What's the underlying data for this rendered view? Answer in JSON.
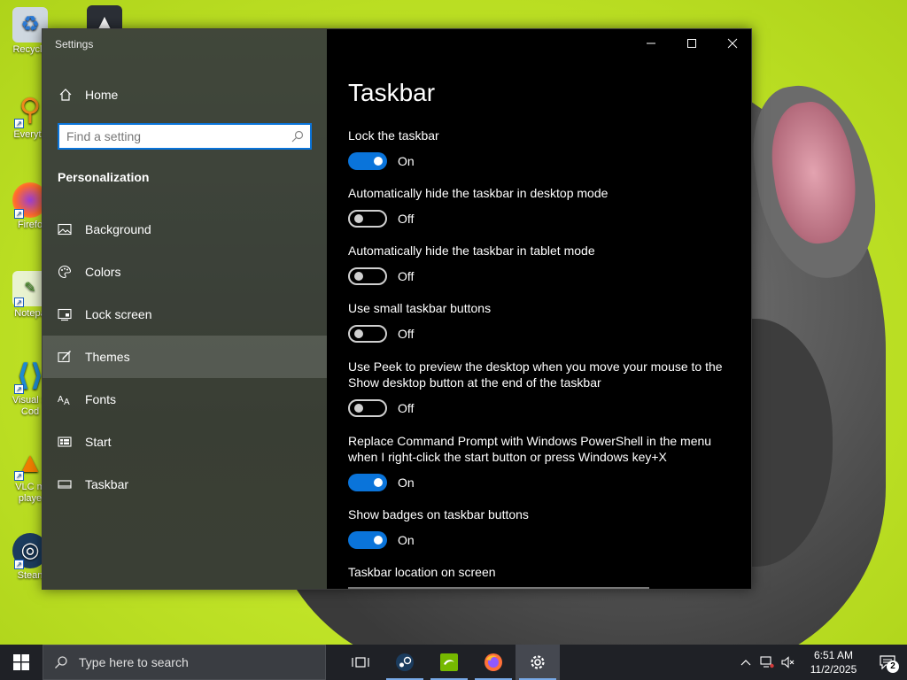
{
  "desktop": {
    "icons": [
      {
        "name": "recycle-bin",
        "label": "Recycle"
      },
      {
        "name": "everything",
        "label": "Everyth"
      },
      {
        "name": "firefox",
        "label": "Firefo"
      },
      {
        "name": "notepad-plus-plus",
        "label": "Notepa"
      },
      {
        "name": "visual-studio-code",
        "label": "Visual S Cod"
      },
      {
        "name": "vlc-media-player",
        "label": "VLC m playe"
      },
      {
        "name": "steam",
        "label": "Stean"
      }
    ]
  },
  "window": {
    "title": "Settings",
    "caption": {
      "minimize": "minimize-icon",
      "maximize": "maximize-icon",
      "close": "close-icon"
    }
  },
  "nav": {
    "home_label": "Home",
    "search_placeholder": "Find a setting",
    "section_heading": "Personalization",
    "items": [
      {
        "label": "Background",
        "icon": "picture-icon"
      },
      {
        "label": "Colors",
        "icon": "palette-icon"
      },
      {
        "label": "Lock screen",
        "icon": "lock-screen-icon"
      },
      {
        "label": "Themes",
        "icon": "themes-icon"
      },
      {
        "label": "Fonts",
        "icon": "fonts-icon"
      },
      {
        "label": "Start",
        "icon": "start-tiles-icon"
      },
      {
        "label": "Taskbar",
        "icon": "taskbar-icon"
      }
    ],
    "selected_index": 3
  },
  "content": {
    "title": "Taskbar",
    "settings": [
      {
        "label": "Lock the taskbar",
        "state": "On",
        "on": true
      },
      {
        "label": "Automatically hide the taskbar in desktop mode",
        "state": "Off",
        "on": false
      },
      {
        "label": "Automatically hide the taskbar in tablet mode",
        "state": "Off",
        "on": false
      },
      {
        "label": "Use small taskbar buttons",
        "state": "Off",
        "on": false
      },
      {
        "label": "Use Peek to preview the desktop when you move your mouse to the Show desktop button at the end of the taskbar",
        "state": "Off",
        "on": false
      },
      {
        "label": "Replace Command Prompt with Windows PowerShell in the menu when I right-click the start button or press Windows key+X",
        "state": "On",
        "on": true
      },
      {
        "label": "Show badges on taskbar buttons",
        "state": "On",
        "on": true
      }
    ],
    "location_label": "Taskbar location on screen"
  },
  "taskbar": {
    "search_placeholder": "Type here to search",
    "apps": [
      "task-view-icon",
      "steam-icon",
      "nvidia-icon",
      "firefox-icon",
      "settings-gear-icon"
    ],
    "time": "6:51 AM",
    "date": "11/2/2025",
    "notification_count": "2"
  },
  "colors": {
    "accent": "#0a74da",
    "content_bg": "#000000",
    "wallpaper": "#c4e72a"
  }
}
